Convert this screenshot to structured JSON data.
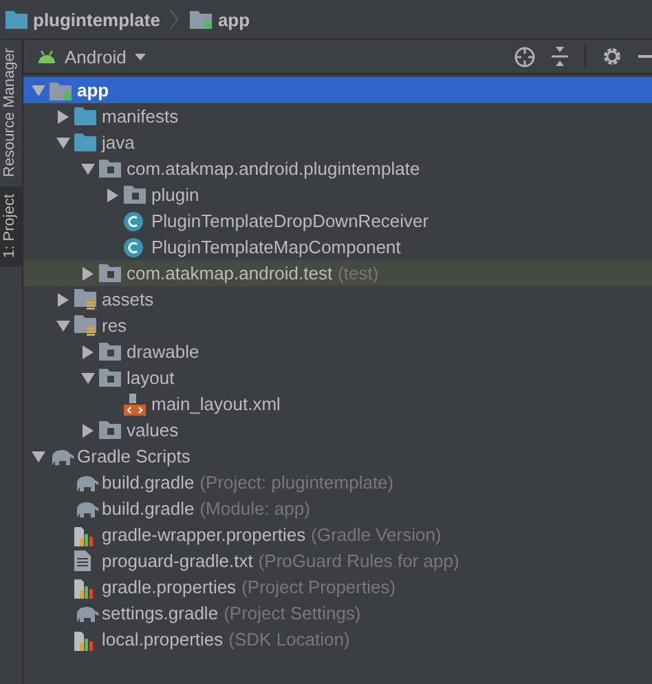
{
  "breadcrumb": [
    {
      "label": "plugintemplate",
      "kind": "project"
    },
    {
      "label": "app",
      "kind": "module"
    }
  ],
  "side_tabs": [
    {
      "label": "Resource Manager",
      "selected": false
    },
    {
      "label": "1: Project",
      "selected": true
    }
  ],
  "view_selector": {
    "value": "Android"
  },
  "tree": [
    {
      "label": "app",
      "kind": "module",
      "expanded": true,
      "selected": true,
      "highlighted": false,
      "children": [
        {
          "label": "manifests",
          "kind": "folder",
          "expanded": false,
          "selected": false,
          "highlighted": false
        },
        {
          "label": "java",
          "kind": "folder",
          "expanded": true,
          "selected": false,
          "highlighted": false,
          "children": [
            {
              "label": "com.atakmap.android.plugintemplate",
              "kind": "package",
              "expanded": true,
              "selected": false,
              "highlighted": false,
              "children": [
                {
                  "label": "plugin",
                  "kind": "package",
                  "expanded": false,
                  "selected": false,
                  "highlighted": false
                },
                {
                  "label": "PluginTemplateDropDownReceiver",
                  "kind": "class",
                  "selected": false,
                  "highlighted": false
                },
                {
                  "label": "PluginTemplateMapComponent",
                  "kind": "class",
                  "selected": false,
                  "highlighted": false
                }
              ]
            },
            {
              "label": "com.atakmap.android.test",
              "note": "(test)",
              "kind": "package",
              "expanded": false,
              "selected": false,
              "highlighted": true
            }
          ]
        },
        {
          "label": "assets",
          "kind": "resfolder",
          "expanded": false,
          "selected": false,
          "highlighted": false
        },
        {
          "label": "res",
          "kind": "resfolder",
          "expanded": true,
          "selected": false,
          "highlighted": false,
          "children": [
            {
              "label": "drawable",
              "kind": "package",
              "expanded": false,
              "selected": false,
              "highlighted": false
            },
            {
              "label": "layout",
              "kind": "package",
              "expanded": true,
              "selected": false,
              "highlighted": false,
              "children": [
                {
                  "label": "main_layout.xml",
                  "kind": "xml",
                  "selected": false,
                  "highlighted": false
                }
              ]
            },
            {
              "label": "values",
              "kind": "package",
              "expanded": false,
              "selected": false,
              "highlighted": false
            }
          ]
        }
      ]
    },
    {
      "label": "Gradle Scripts",
      "kind": "gradle",
      "expanded": true,
      "selected": false,
      "highlighted": false,
      "children": [
        {
          "label": "build.gradle",
          "note": "(Project: plugintemplate)",
          "kind": "gradle",
          "selected": false,
          "highlighted": false
        },
        {
          "label": "build.gradle",
          "note": "(Module: app)",
          "kind": "gradle",
          "selected": false,
          "highlighted": false
        },
        {
          "label": "gradle-wrapper.properties",
          "note": "(Gradle Version)",
          "kind": "properties",
          "selected": false,
          "highlighted": false
        },
        {
          "label": "proguard-gradle.txt",
          "note": "(ProGuard Rules for app)",
          "kind": "text",
          "selected": false,
          "highlighted": false
        },
        {
          "label": "gradle.properties",
          "note": "(Project Properties)",
          "kind": "properties",
          "selected": false,
          "highlighted": false
        },
        {
          "label": "settings.gradle",
          "note": "(Project Settings)",
          "kind": "gradle",
          "selected": false,
          "highlighted": false
        },
        {
          "label": "local.properties",
          "note": "(SDK Location)",
          "kind": "properties",
          "selected": false,
          "highlighted": false
        }
      ]
    }
  ]
}
